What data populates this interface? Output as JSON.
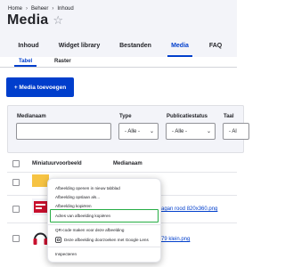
{
  "breadcrumb": {
    "home": "Home",
    "beheer": "Beheer",
    "inhoud": "Inhoud"
  },
  "page": {
    "title": "Media"
  },
  "tabs": [
    {
      "label": "Inhoud"
    },
    {
      "label": "Widget library"
    },
    {
      "label": "Bestanden"
    },
    {
      "label": "Media"
    },
    {
      "label": "FAQ"
    }
  ],
  "subtabs": [
    {
      "label": "Tabel"
    },
    {
      "label": "Raster"
    }
  ],
  "add_button": {
    "label": "+ Media toevoegen"
  },
  "filters": {
    "medianaam_label": "Medianaam",
    "type_label": "Type",
    "type_value": "- Alle -",
    "publicatiestatus_label": "Publicatiestatus",
    "publicatiestatus_value": "- Alle -",
    "taal_label": "Taal",
    "taal_value": "- Al"
  },
  "table": {
    "headers": [
      "Miniatuurvoorbeeld",
      "Medianaam"
    ],
    "rows": [
      {
        "name_fragment": ""
      },
      {
        "name_fragment": "agan rood 820x360.png"
      },
      {
        "name_fragment": "79 klein.png"
      }
    ]
  },
  "context_menu": {
    "items": [
      "Afbeelding openen in nieuw tabblad",
      "Afbeelding opslaan als...",
      "Afbeelding kopiëren",
      "Adres van afbeelding kopiëren",
      "QR-code maken voor deze afbeelding",
      "Deze afbeelding doorzoeken met Google Lens",
      "Inspecteren"
    ],
    "highlight_color": "#26ad44"
  },
  "colors": {
    "accent": "#003ecc",
    "header_bg": "#f3f4f9",
    "text": "#232429"
  }
}
